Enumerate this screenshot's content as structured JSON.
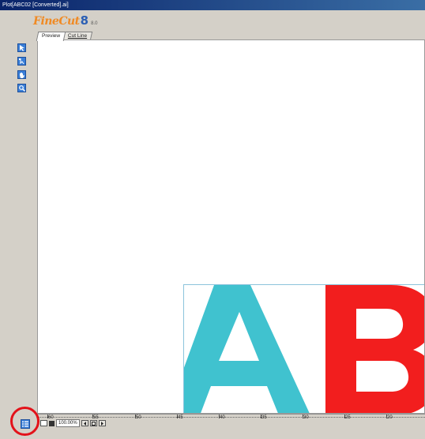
{
  "window": {
    "title": "Plot[ABC02 [Converted].ai]"
  },
  "logo": {
    "brand": "FineCut",
    "major": "8",
    "version": "8.0"
  },
  "tabs": [
    {
      "label": "Preview"
    },
    {
      "label": "Cut Line"
    }
  ],
  "toolbar": {
    "tools": [
      "select-icon",
      "node-edit-icon",
      "hand-icon",
      "zoom-icon"
    ]
  },
  "artwork": {
    "letters": [
      "A",
      "B"
    ],
    "colors": {
      "a": "#40c2cf",
      "b": "#f21e1e"
    }
  },
  "ruler": {
    "ticks": [
      "60",
      "55",
      "50",
      "45",
      "40",
      "35",
      "30",
      "25",
      "20"
    ]
  },
  "zoom": {
    "value": "100.00%"
  },
  "colors": {
    "accent": "#3a7fd8",
    "titlebar": "#0a246a",
    "highlight": "#e3121a"
  }
}
